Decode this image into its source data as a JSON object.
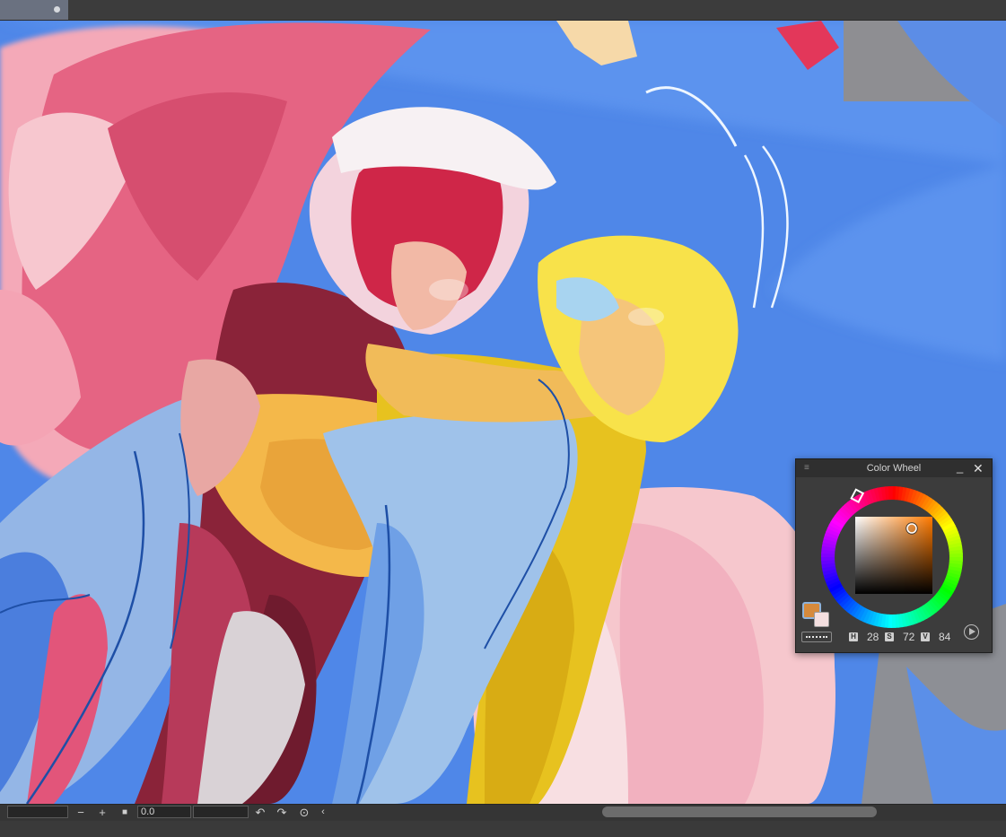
{
  "panel": {
    "title": "Color Wheel",
    "hsv": {
      "h_label": "H",
      "h": "28",
      "s_label": "S",
      "s": "72",
      "v_label": "V",
      "v": "84"
    },
    "main_color": "#d68a3c",
    "sub_color": "#f4dfe0"
  },
  "bottombar": {
    "angle_value": "0.0"
  },
  "icons": [
    "menu-icon",
    "minimize-icon",
    "close-icon",
    "zoom-out-icon",
    "zoom-in-icon",
    "reset-icon",
    "rotate-left-icon",
    "rotate-right-icon",
    "rotate-reset-icon",
    "collapse-icon",
    "play-icon"
  ]
}
